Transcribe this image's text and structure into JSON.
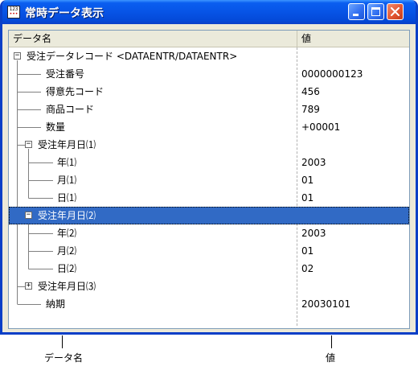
{
  "window": {
    "title": "常時データ表示",
    "icon_text": "123",
    "icon_name": "app-icon"
  },
  "columns": {
    "name": "データ名",
    "value": "値"
  },
  "rows": [
    {
      "label": "受注データレコード <DATAENTR/DATAENTR>",
      "value": "",
      "expander": "−"
    },
    {
      "label": "受注番号",
      "value": "0000000123"
    },
    {
      "label": "得意先コード",
      "value": "456"
    },
    {
      "label": "商品コード",
      "value": "789"
    },
    {
      "label": "数量",
      "value": "+00001"
    },
    {
      "label": "受注年月日⑴",
      "value": "",
      "expander": "−"
    },
    {
      "label": "年⑴",
      "value": "2003"
    },
    {
      "label": "月⑴",
      "value": "01"
    },
    {
      "label": "日⑴",
      "value": "01"
    },
    {
      "label": "受注年月日⑵",
      "value": "",
      "expander": "−",
      "selected": true
    },
    {
      "label": "年⑵",
      "value": "2003"
    },
    {
      "label": "月⑵",
      "value": "01"
    },
    {
      "label": "日⑵",
      "value": "02"
    },
    {
      "label": "受注年月日⑶",
      "value": "",
      "expander": "+"
    },
    {
      "label": "納期",
      "value": "20030101"
    }
  ],
  "callouts": {
    "name_label": "データ名",
    "value_label": "値"
  },
  "colors": {
    "titlebar": "#0a5ef0",
    "selection": "#316ac5",
    "close_button": "#e0532f"
  }
}
